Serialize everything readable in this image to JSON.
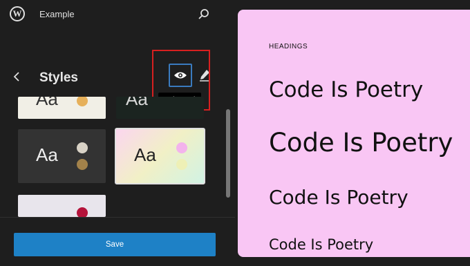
{
  "topbar": {
    "site_title": "Example"
  },
  "panel": {
    "title": "Styles",
    "tooltip": "Style Book",
    "card_text": "Aa"
  },
  "footer": {
    "save_label": "Save"
  },
  "preview": {
    "section_label": "HEADINGS",
    "headings": [
      "Code Is Poetry",
      "Code Is Poetry",
      "Code Is Poetry",
      "Code Is Poetry"
    ]
  },
  "colors": {
    "accent": "#1e81c6",
    "highlight": "#d82020",
    "preview_bg": "#f9c6f4"
  }
}
